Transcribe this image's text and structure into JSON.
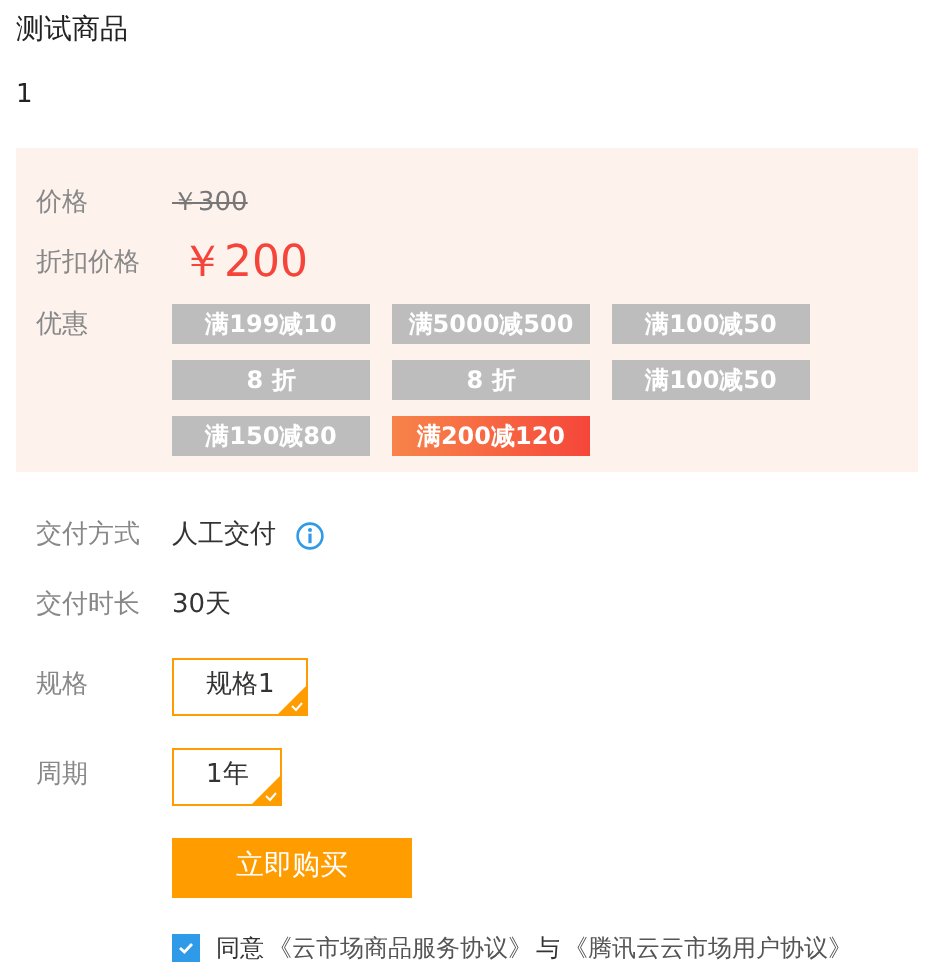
{
  "product": {
    "title": "测试商品",
    "subtitle": "1"
  },
  "pricing": {
    "price_label": "价格",
    "original_price": "￥300",
    "discount_label": "折扣价格",
    "discount_price": "￥200",
    "coupon_label": "优惠",
    "coupons": [
      {
        "text": "满199减10",
        "selected": false
      },
      {
        "text": "满5000减500",
        "selected": false
      },
      {
        "text": "满100减50",
        "selected": false
      },
      {
        "text": "8 折",
        "selected": false
      },
      {
        "text": "8 折",
        "selected": false
      },
      {
        "text": "满100减50",
        "selected": false
      },
      {
        "text": "满150减80",
        "selected": false
      },
      {
        "text": "满200减120",
        "selected": true
      }
    ]
  },
  "delivery": {
    "method_label": "交付方式",
    "method": "人工交付",
    "duration_label": "交付时长",
    "duration": "30天"
  },
  "spec": {
    "label": "规格",
    "options": [
      {
        "text": "规格1",
        "selected": true
      }
    ]
  },
  "period": {
    "label": "周期",
    "options": [
      {
        "text": "1年",
        "selected": true
      }
    ]
  },
  "buy_button": "立即购买",
  "agreement": {
    "checked": true,
    "prefix": "同意",
    "link_1": "《云市场商品服务协议》",
    "joiner": "与",
    "link_2": "《腾讯云云市场用户协议》"
  }
}
